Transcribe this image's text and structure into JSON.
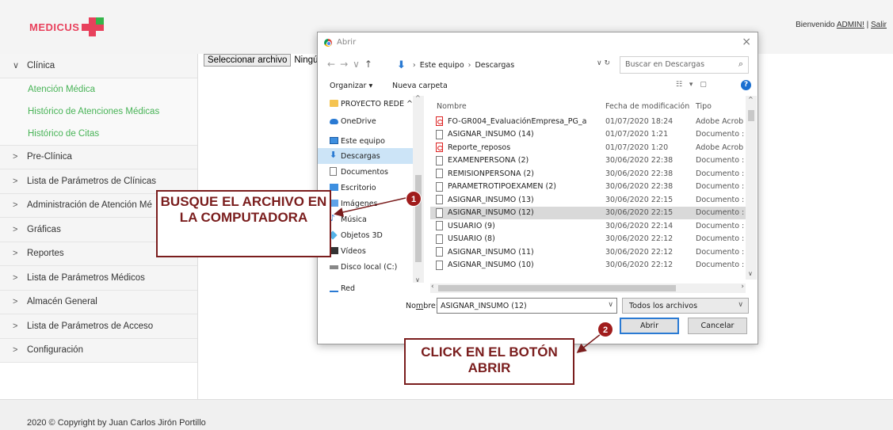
{
  "header": {
    "logo_text": "MEDICUS",
    "welcome_prefix": "Bienvenido ",
    "user": "ADMIN!",
    "separator": " | ",
    "logout": "Salir"
  },
  "sidebar": {
    "items": [
      {
        "label": "Clínica",
        "chevron": "∨"
      },
      {
        "label": "Pre-Clínica",
        "chevron": ">"
      },
      {
        "label": "Lista de Parámetros de Clínicas",
        "chevron": ">"
      },
      {
        "label": "Administración de Atención Mé",
        "chevron": ">"
      },
      {
        "label": "Gráficas",
        "chevron": ">"
      },
      {
        "label": "Reportes",
        "chevron": ">"
      },
      {
        "label": "Lista de Parámetros Médicos",
        "chevron": ">"
      },
      {
        "label": "Almacén General",
        "chevron": ">"
      },
      {
        "label": "Lista de Parámetros de Acceso",
        "chevron": ">"
      },
      {
        "label": "Configuración",
        "chevron": ">"
      }
    ],
    "submenu": [
      {
        "label": "Atención Médica"
      },
      {
        "label": "Histórico de Atenciones Médicas"
      },
      {
        "label": "Histórico de Citas"
      }
    ]
  },
  "file_input": {
    "button_label": "Seleccionar archivo",
    "status": "Ningún"
  },
  "footer": {
    "text": "2020 © Copyright by Juan Carlos Jirón Portillo"
  },
  "dialog": {
    "title": "Abrir",
    "close": "×",
    "breadcrumb": [
      "Este equipo",
      "Descargas"
    ],
    "search_placeholder": "Buscar en Descargas",
    "toolbar": {
      "organize": "Organizar ▾",
      "new_folder": "Nueva carpeta",
      "help": "?"
    },
    "nav_items": [
      {
        "label": "PROYECTO REDE ^",
        "icon": "folder"
      },
      {
        "label": "OneDrive",
        "icon": "cloud"
      },
      {
        "label": "Este equipo",
        "icon": "pc"
      },
      {
        "label": "Descargas",
        "icon": "dl",
        "selected": true
      },
      {
        "label": "Documentos",
        "icon": "doc"
      },
      {
        "label": "Escritorio",
        "icon": "desk"
      },
      {
        "label": "Imágenes",
        "icon": "img"
      },
      {
        "label": "Música",
        "icon": "music"
      },
      {
        "label": "Objetos 3D",
        "icon": "cube"
      },
      {
        "label": "Vídeos",
        "icon": "video"
      },
      {
        "label": "Disco local (C:)",
        "icon": "disk"
      },
      {
        "label": "Red",
        "icon": "net"
      }
    ],
    "columns": [
      "Nombre",
      "Fecha de modificación",
      "Tipo"
    ],
    "files": [
      {
        "name": "FO-GR004_EvaluaciónEmpresa_PG_a",
        "date": "01/07/2020 18:24",
        "type": "Adobe Acrob",
        "icon": "pdf"
      },
      {
        "name": "ASIGNAR_INSUMO (14)",
        "date": "01/07/2020 1:21",
        "type": "Documento :",
        "icon": "doc"
      },
      {
        "name": "Reporte_reposos",
        "date": "01/07/2020 1:20",
        "type": "Adobe Acrob",
        "icon": "pdf"
      },
      {
        "name": "EXAMENPERSONA (2)",
        "date": "30/06/2020 22:38",
        "type": "Documento :",
        "icon": "doc"
      },
      {
        "name": "REMISIONPERSONA (2)",
        "date": "30/06/2020 22:38",
        "type": "Documento :",
        "icon": "doc"
      },
      {
        "name": "PARAMETROTIPOEXAMEN (2)",
        "date": "30/06/2020 22:38",
        "type": "Documento :",
        "icon": "doc"
      },
      {
        "name": "ASIGNAR_INSUMO (13)",
        "date": "30/06/2020 22:15",
        "type": "Documento :",
        "icon": "doc"
      },
      {
        "name": "ASIGNAR_INSUMO (12)",
        "date": "30/06/2020 22:15",
        "type": "Documento :",
        "icon": "doc",
        "selected": true
      },
      {
        "name": "USUARIO (9)",
        "date": "30/06/2020 22:14",
        "type": "Documento :",
        "icon": "doc"
      },
      {
        "name": "USUARIO (8)",
        "date": "30/06/2020 22:12",
        "type": "Documento :",
        "icon": "doc"
      },
      {
        "name": "ASIGNAR_INSUMO (11)",
        "date": "30/06/2020 22:12",
        "type": "Documento :",
        "icon": "doc"
      },
      {
        "name": "ASIGNAR_INSUMO (10)",
        "date": "30/06/2020 22:12",
        "type": "Documento :",
        "icon": "doc"
      }
    ],
    "name_label_pre": "No",
    "name_label_u": "m",
    "name_label_post": "bre:",
    "filename": "ASIGNAR_INSUMO (12)",
    "filter": "Todos los archivos",
    "open_button": "Abrir",
    "cancel_button": "Cancelar"
  },
  "annotations": {
    "callout1": "BUSQUE EL ARCHIVO EN LA COMPUTADORA",
    "callout2": "CLICK EN EL BOTÓN ABRIR",
    "badge1": "1",
    "badge2": "2",
    "color": "#7a1d1d"
  }
}
